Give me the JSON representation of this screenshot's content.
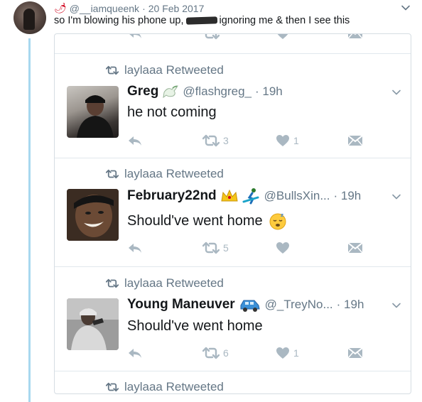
{
  "outer_tweet": {
    "emoji_prefix": "🌶",
    "handle": "@__iamqueenk",
    "separator": "·",
    "date": "20 Feb 2017",
    "text_before": "so I'm blowing his phone up,",
    "text_after": "ignoring me & then I see this"
  },
  "screenshot": {
    "tweets": [
      {
        "retweeted_by": "laylaaa Retweeted",
        "display_name": "Greg",
        "handle": "@flashgreg_",
        "time": "· 19h",
        "text": "he not coming",
        "retweet_count": "3",
        "like_count": "1"
      },
      {
        "retweeted_by": "laylaaa Retweeted",
        "display_name": "February22nd",
        "handle": "@BullsXin...",
        "time": "· 19h",
        "text": "Should've went home",
        "retweet_count": "5",
        "like_count": ""
      },
      {
        "retweeted_by": "laylaaa Retweeted",
        "display_name": "Young Maneuver",
        "handle": "@_TreyNo...",
        "time": "· 19h",
        "text": "Should've went home",
        "retweet_count": "6",
        "like_count": "1"
      },
      {
        "retweeted_by": "laylaaa Retweeted"
      }
    ]
  },
  "colors": {
    "thread_line": "#a8d8ef",
    "muted_text": "#657786",
    "icon_gray": "#aab8c2"
  },
  "icons": [
    "chili-pepper-icon",
    "chevron-down-icon",
    "retweet-icon",
    "reply-icon",
    "heart-icon",
    "direct-message-icon",
    "dove-icon",
    "crown-icon",
    "snowboarder-icon",
    "car-icon",
    "sleeping-face-icon"
  ]
}
